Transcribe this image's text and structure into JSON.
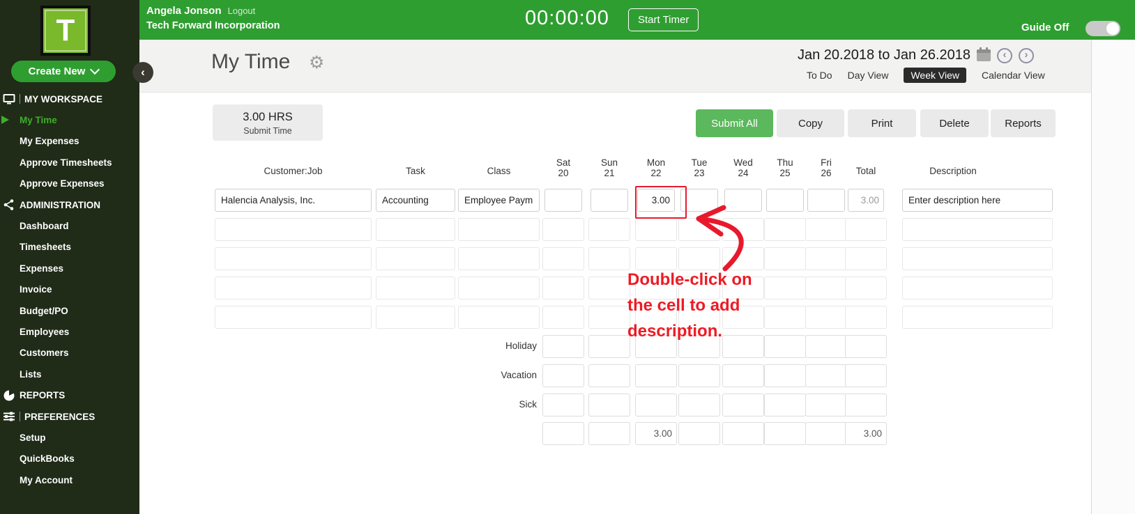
{
  "sidebar": {
    "logo_letter": "T",
    "create_new_label": "Create New",
    "items": [
      {
        "label": "MY WORKSPACE",
        "type": "section",
        "icon": "monitor-icon"
      },
      {
        "label": "My Time",
        "type": "item",
        "active": true
      },
      {
        "label": "My Expenses",
        "type": "item"
      },
      {
        "label": "Approve Timesheets",
        "type": "item"
      },
      {
        "label": "Approve Expenses",
        "type": "item"
      },
      {
        "label": "ADMINISTRATION",
        "type": "section",
        "icon": "share-icon"
      },
      {
        "label": "Dashboard",
        "type": "item"
      },
      {
        "label": "Timesheets",
        "type": "item"
      },
      {
        "label": "Expenses",
        "type": "item"
      },
      {
        "label": "Invoice",
        "type": "item"
      },
      {
        "label": "Budget/PO",
        "type": "item"
      },
      {
        "label": "Employees",
        "type": "item"
      },
      {
        "label": "Customers",
        "type": "item"
      },
      {
        "label": "Lists",
        "type": "item"
      },
      {
        "label": "REPORTS",
        "type": "section",
        "icon": "pie-icon"
      },
      {
        "label": "PREFERENCES",
        "type": "section",
        "icon": "sliders-icon"
      },
      {
        "label": "Setup",
        "type": "item"
      },
      {
        "label": "QuickBooks",
        "type": "item"
      },
      {
        "label": "My Account",
        "type": "item"
      }
    ]
  },
  "topbar": {
    "user_name": "Angela Jonson",
    "logout_label": "Logout",
    "company": "Tech Forward Incorporation",
    "timer_value": "00:00:00",
    "start_timer_label": "Start Timer",
    "guide_label": "Guide Off"
  },
  "page_header": {
    "title": "My Time",
    "date_range": "Jan 20.2018 to Jan 26.2018",
    "views": [
      "To Do",
      "Day View",
      "Week View",
      "Calendar View"
    ],
    "selected_view": "Week View",
    "prev_arrow": "‹",
    "next_arrow": "›",
    "collapse_arrow": "‹"
  },
  "summary": {
    "hours": "3.00 HRS",
    "submit_label": "Submit Time"
  },
  "actions": [
    "Submit All",
    "Copy",
    "Print",
    "Delete",
    "Reports"
  ],
  "timesheet": {
    "headers": {
      "customer": "Customer:Job",
      "task": "Task",
      "class": "Class",
      "total": "Total",
      "description": "Description"
    },
    "days": [
      {
        "name": "Sat",
        "num": "20"
      },
      {
        "name": "Sun",
        "num": "21"
      },
      {
        "name": "Mon",
        "num": "22"
      },
      {
        "name": "Tue",
        "num": "23"
      },
      {
        "name": "Wed",
        "num": "24"
      },
      {
        "name": "Thu",
        "num": "25"
      },
      {
        "name": "Fri",
        "num": "26"
      }
    ],
    "row1": {
      "customer": "Halencia Analysis, Inc.",
      "task": "Accounting",
      "class": "Employee Paym",
      "mon_value": "3.00",
      "total": "3.00",
      "description": "Enter description here"
    },
    "leave_rows": [
      "Holiday",
      "Vacation",
      "Sick"
    ],
    "totals_row": {
      "mon": "3.00",
      "total": "3.00"
    }
  },
  "annotation": {
    "line1": "Double-click on",
    "line2": "the cell to add",
    "line3": "description."
  },
  "colors": {
    "header_green": "#2f9e31",
    "sidebar_dark": "#202b18",
    "logo_green": "#7ab82c",
    "submit_green": "#5cb85c",
    "active_green": "#3fae2a",
    "annotation_red": "#ed1b24"
  }
}
